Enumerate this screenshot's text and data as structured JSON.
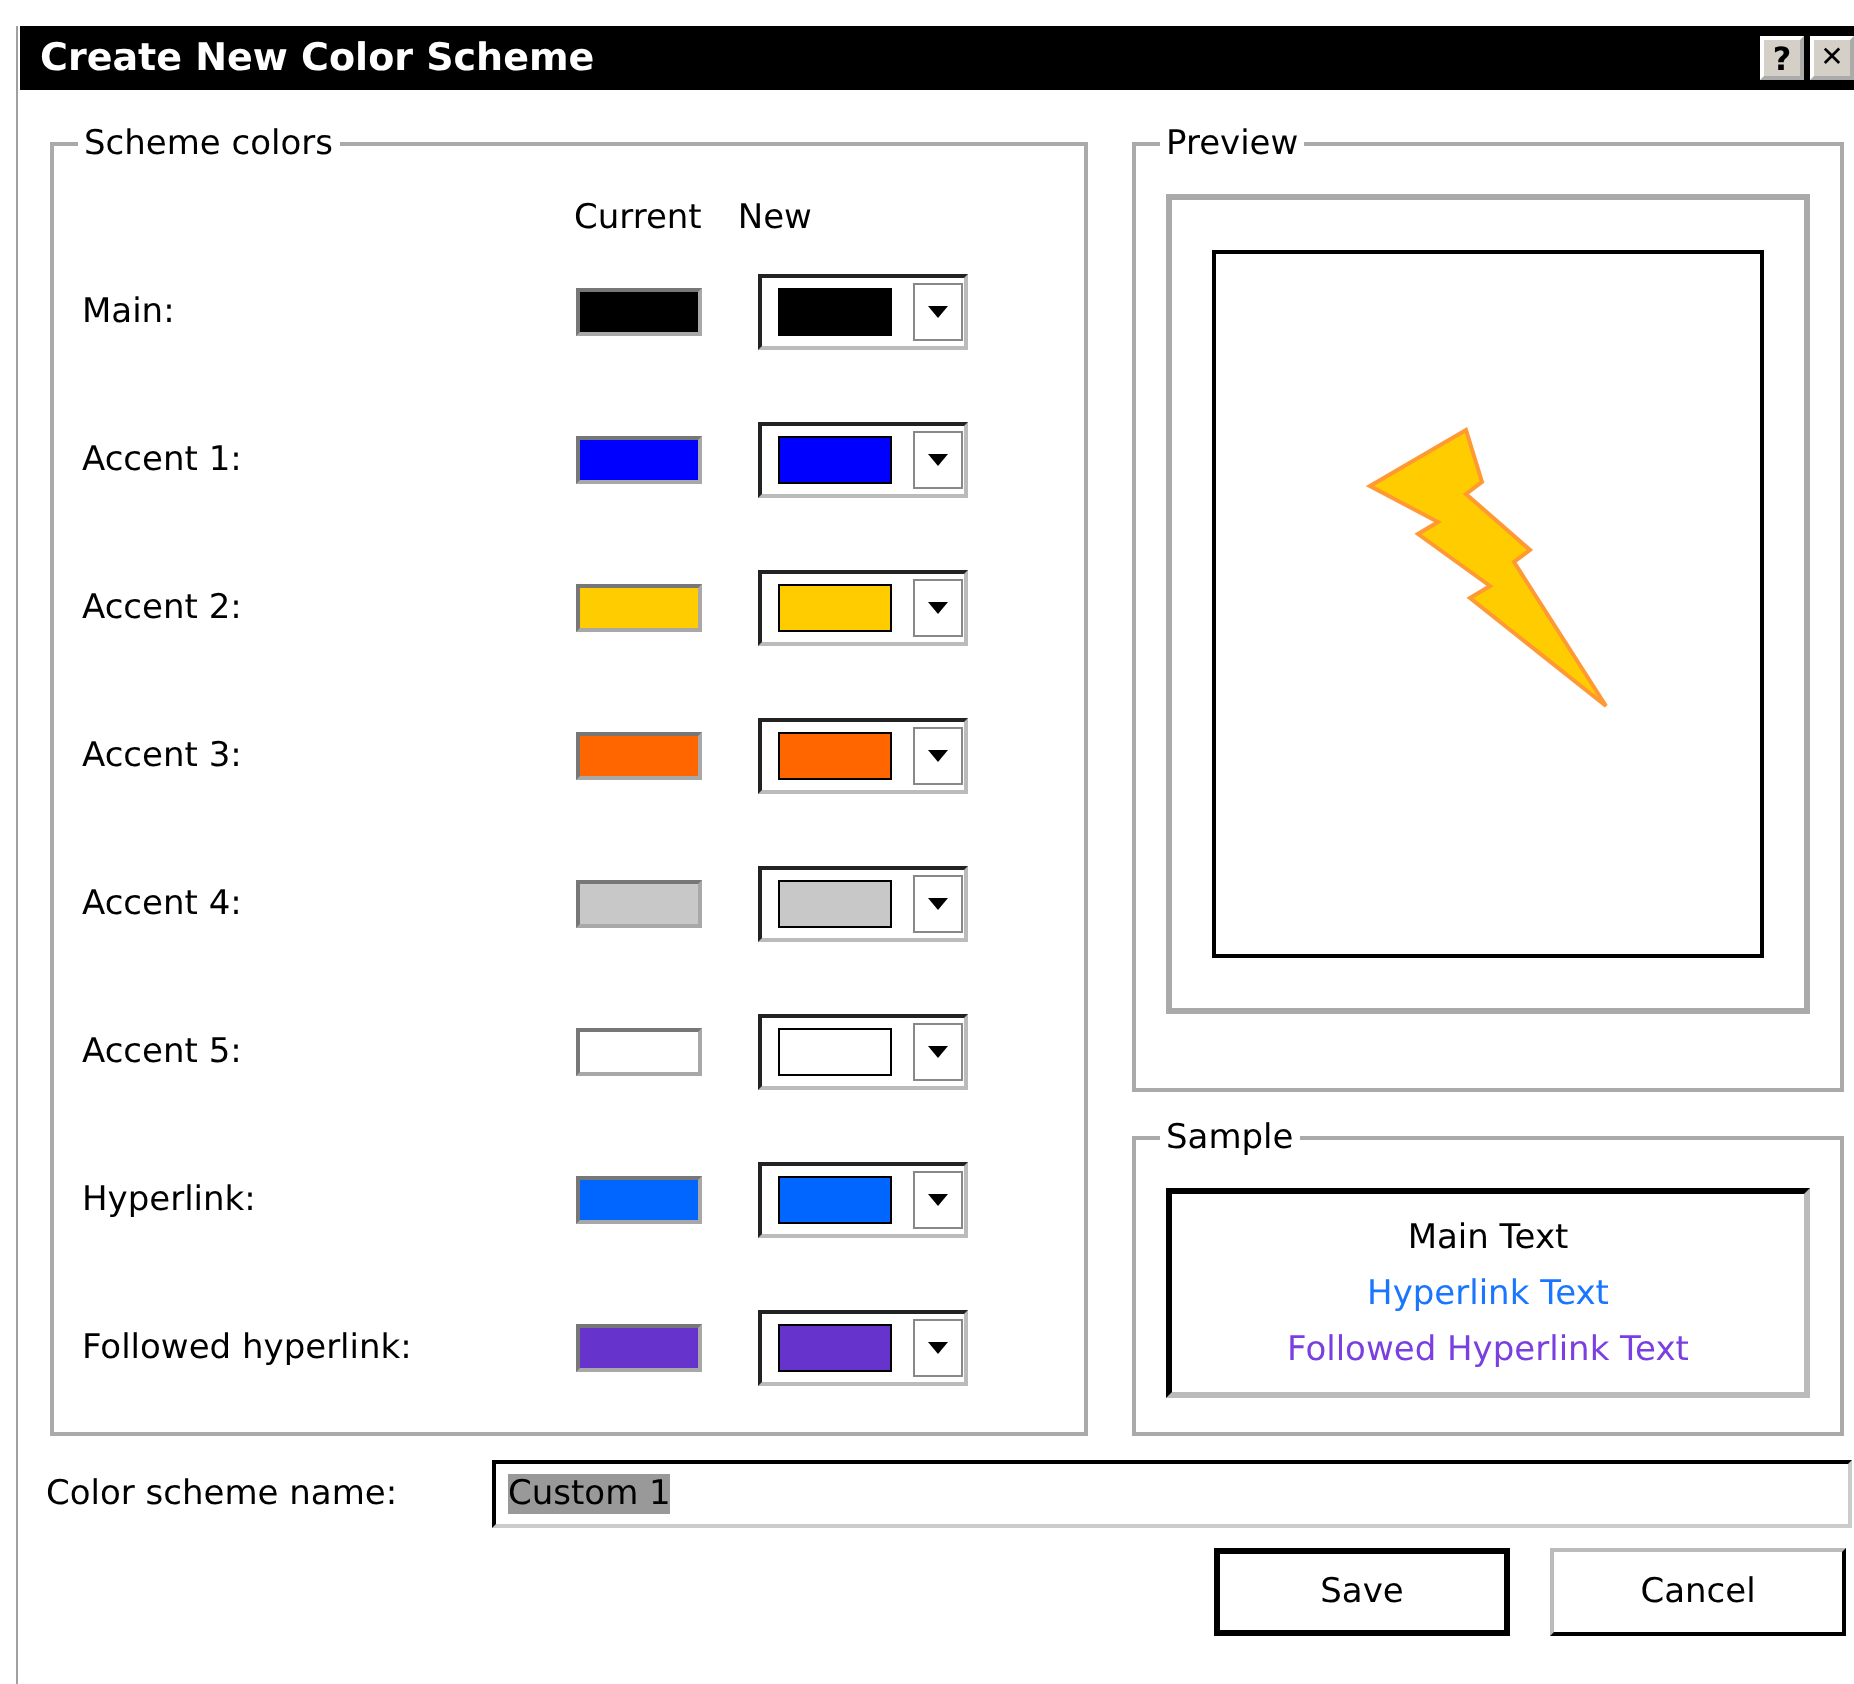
{
  "window": {
    "title": "Create New Color Scheme",
    "buttons": [
      {
        "kind": "help",
        "label": "?"
      },
      {
        "kind": "close",
        "label": "✕"
      }
    ]
  },
  "scheme_colors": {
    "title": "Scheme colors",
    "column_headers": [
      "Current",
      "New"
    ],
    "rows": [
      {
        "label": "Main:",
        "current": {
          "color": "#000000"
        },
        "new": {
          "color": "#000000"
        }
      },
      {
        "label": "Accent 1:",
        "current": {
          "color": "#0000ff"
        },
        "new": {
          "color": "#0000ff"
        }
      },
      {
        "label": "Accent 2:",
        "current": {
          "color": "#ffcc00"
        },
        "new": {
          "color": "#ffcc00"
        }
      },
      {
        "label": "Accent 3:",
        "current": {
          "color": "#ff6600"
        },
        "new": {
          "color": "#ff6600"
        }
      },
      {
        "label": "Accent 4:",
        "current": {
          "color": "#c8c8c8"
        },
        "new": {
          "color": "#c8c8c8"
        }
      },
      {
        "label": "Accent 5:",
        "current": {
          "color": "#ffffff"
        },
        "new": {
          "color": "#ffffff"
        }
      },
      {
        "label": "Hyperlink:",
        "current": {
          "color": "#0066ff"
        },
        "new": {
          "color": "#0066ff"
        }
      },
      {
        "label": "Followed hyperlink:",
        "current": {
          "color": "#6633cc"
        },
        "new": {
          "color": "#6633cc"
        }
      }
    ]
  },
  "preview": {
    "title": "Preview"
  },
  "sample": {
    "title": "Sample",
    "lines": [
      {
        "text": "Main Text",
        "color": "#000000"
      },
      {
        "text": "Hyperlink Text",
        "color": "#1a75ff"
      },
      {
        "text": "Followed Hyperlink Text",
        "color": "#7a3fe0"
      }
    ]
  },
  "name_field": {
    "label": "Color scheme name:",
    "value": "Custom 1",
    "text_selected": true
  },
  "buttons": [
    {
      "label": "Save",
      "default": true
    },
    {
      "label": "Cancel",
      "default": false
    }
  ]
}
